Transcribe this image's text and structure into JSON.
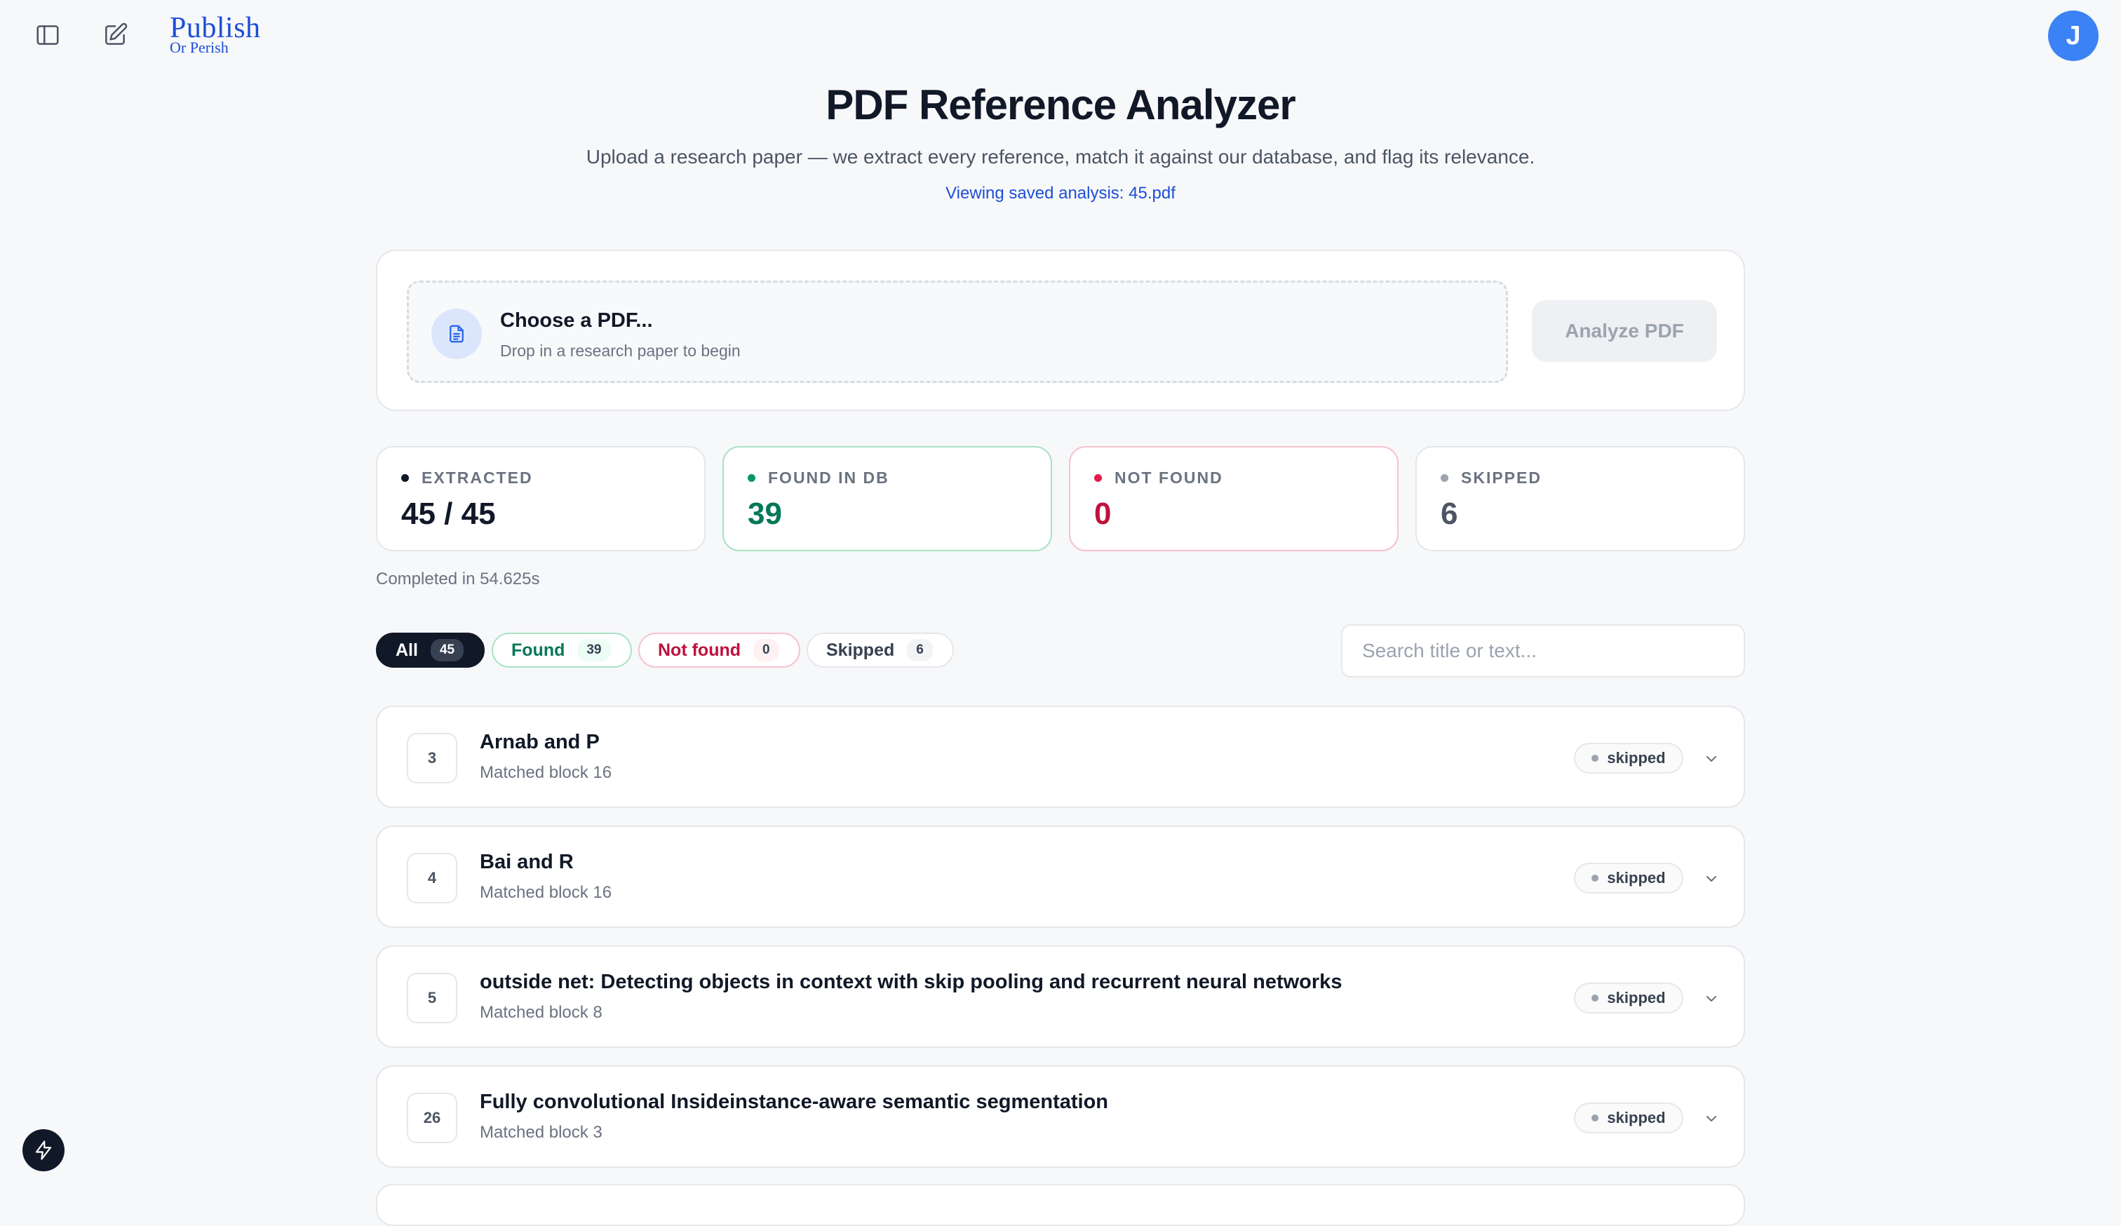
{
  "app": {
    "logo_main": "Publish",
    "logo_sub": "Or Perish",
    "avatar_initial": "J"
  },
  "header": {
    "title": "PDF Reference Analyzer",
    "subtitle": "Upload a research paper — we extract every reference, match it against our database, and flag its relevance.",
    "saved_analysis": "Viewing saved analysis: 45.pdf"
  },
  "upload": {
    "choose_label": "Choose a PDF...",
    "choose_hint": "Drop in a research paper to begin",
    "analyze_label": "Analyze PDF"
  },
  "stats": [
    {
      "label": "EXTRACTED",
      "value": "45 / 45",
      "color": "#111827"
    },
    {
      "label": "FOUND IN DB",
      "value": "39",
      "color": "#047857"
    },
    {
      "label": "NOT FOUND",
      "value": "0",
      "color": "#be123c"
    },
    {
      "label": "SKIPPED",
      "value": "6",
      "color": "#9ca3af"
    }
  ],
  "completed_text": "Completed in 54.625s",
  "filters": [
    {
      "label": "All",
      "count": "45"
    },
    {
      "label": "Found",
      "count": "39"
    },
    {
      "label": "Not found",
      "count": "0"
    },
    {
      "label": "Skipped",
      "count": "6"
    }
  ],
  "search": {
    "placeholder": "Search title or text..."
  },
  "references": [
    {
      "num": "3",
      "title": "Arnab and P",
      "sub": "Matched block 16",
      "status": "skipped"
    },
    {
      "num": "4",
      "title": "Bai and R",
      "sub": "Matched block 16",
      "status": "skipped"
    },
    {
      "num": "5",
      "title": "outside net: Detecting objects in context with skip pooling and recurrent neural networks",
      "sub": "Matched block 8",
      "status": "skipped"
    },
    {
      "num": "26",
      "title": "Fully convolutional Insideinstance-aware semantic segmentation",
      "sub": "Matched block 3",
      "status": "skipped"
    }
  ],
  "icons": {
    "sidebar": "sidebar-toggle-icon",
    "compose": "compose-icon",
    "file": "document-icon",
    "chevron": "chevron-down-icon",
    "bolt": "lightning-icon"
  }
}
